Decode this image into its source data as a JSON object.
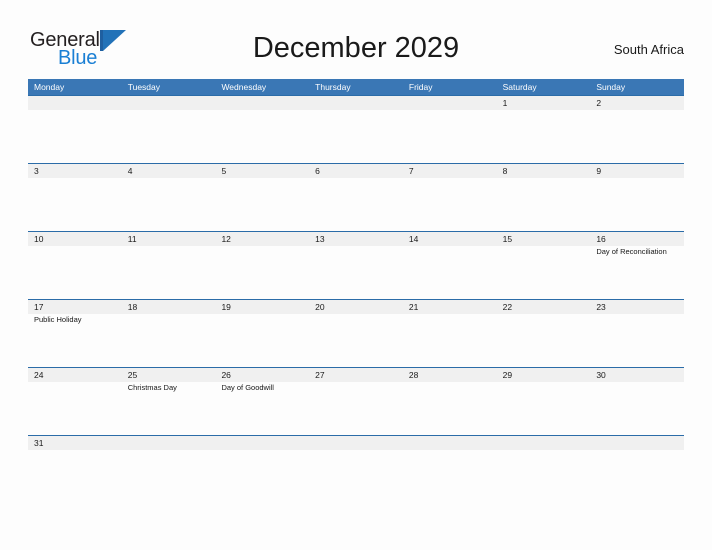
{
  "logo": {
    "word_one": "General",
    "word_two": "Blue",
    "flag_icon": "flag-triangle-icon",
    "accent_color": "#2272b8"
  },
  "header": {
    "title": "December 2029",
    "country": "South Africa"
  },
  "colors": {
    "header_blue": "#3a77b5",
    "row_rule_blue": "#2b6ca8",
    "daynum_band": "#f0f0f0",
    "page_background": "#fdfdfd",
    "text": "#1a1a1a"
  },
  "calendar": {
    "weekdays": [
      "Monday",
      "Tuesday",
      "Wednesday",
      "Thursday",
      "Friday",
      "Saturday",
      "Sunday"
    ],
    "weeks": [
      {
        "height": "tall",
        "days": [
          {
            "num": "",
            "event": ""
          },
          {
            "num": "",
            "event": ""
          },
          {
            "num": "",
            "event": ""
          },
          {
            "num": "",
            "event": ""
          },
          {
            "num": "",
            "event": ""
          },
          {
            "num": "1",
            "event": ""
          },
          {
            "num": "2",
            "event": ""
          }
        ]
      },
      {
        "height": "tall",
        "days": [
          {
            "num": "3",
            "event": ""
          },
          {
            "num": "4",
            "event": ""
          },
          {
            "num": "5",
            "event": ""
          },
          {
            "num": "6",
            "event": ""
          },
          {
            "num": "7",
            "event": ""
          },
          {
            "num": "8",
            "event": ""
          },
          {
            "num": "9",
            "event": ""
          }
        ]
      },
      {
        "height": "tall",
        "days": [
          {
            "num": "10",
            "event": ""
          },
          {
            "num": "11",
            "event": ""
          },
          {
            "num": "12",
            "event": ""
          },
          {
            "num": "13",
            "event": ""
          },
          {
            "num": "14",
            "event": ""
          },
          {
            "num": "15",
            "event": ""
          },
          {
            "num": "16",
            "event": "Day of Reconciliation"
          }
        ]
      },
      {
        "height": "tall",
        "days": [
          {
            "num": "17",
            "event": "Public Holiday"
          },
          {
            "num": "18",
            "event": ""
          },
          {
            "num": "19",
            "event": ""
          },
          {
            "num": "20",
            "event": ""
          },
          {
            "num": "21",
            "event": ""
          },
          {
            "num": "22",
            "event": ""
          },
          {
            "num": "23",
            "event": ""
          }
        ]
      },
      {
        "height": "tall",
        "days": [
          {
            "num": "24",
            "event": ""
          },
          {
            "num": "25",
            "event": "Christmas Day"
          },
          {
            "num": "26",
            "event": "Day of Goodwill"
          },
          {
            "num": "27",
            "event": ""
          },
          {
            "num": "28",
            "event": ""
          },
          {
            "num": "29",
            "event": ""
          },
          {
            "num": "30",
            "event": ""
          }
        ]
      },
      {
        "height": "short",
        "days": [
          {
            "num": "31",
            "event": ""
          },
          {
            "num": "",
            "event": ""
          },
          {
            "num": "",
            "event": ""
          },
          {
            "num": "",
            "event": ""
          },
          {
            "num": "",
            "event": ""
          },
          {
            "num": "",
            "event": ""
          },
          {
            "num": "",
            "event": ""
          }
        ]
      }
    ]
  }
}
